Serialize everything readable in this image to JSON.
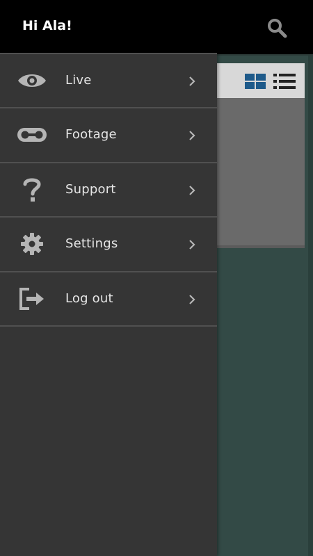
{
  "drawer": {
    "greeting": "Hi Ala!",
    "items": [
      {
        "label": "Live",
        "icon": "eye-icon"
      },
      {
        "label": "Footage",
        "icon": "cassette-icon"
      },
      {
        "label": "Support",
        "icon": "question-icon"
      },
      {
        "label": "Settings",
        "icon": "gear-icon"
      },
      {
        "label": "Log out",
        "icon": "logout-icon"
      }
    ]
  },
  "background_app": {
    "view_modes": [
      "grid-view-icon",
      "list-view-icon"
    ],
    "active_view": "grid-view-icon"
  },
  "colors": {
    "drawer_bg": "#353535",
    "header_bg": "#000000",
    "accent": "#1e5a8a",
    "divider": "#505050",
    "text": "#e6e6e6",
    "app_bg": "#334a46"
  }
}
